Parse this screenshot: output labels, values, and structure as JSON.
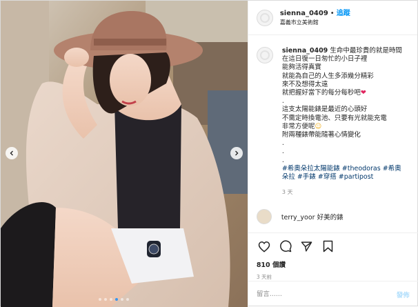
{
  "header": {
    "username": "sienna_0409",
    "separator": "•",
    "follow_label": "追蹤",
    "location": "嘉義市立美術館"
  },
  "caption": {
    "username": "sienna_0409",
    "lines": [
      "生命中最珍貴的就是時間",
      "在這日復一日匆忙的小日子裡",
      "能夠活得真實",
      "就能為自己的人生多添幾分精彩",
      "來不及想得太遠",
      "就把握好當下的每分每秒吧",
      ".",
      "這支太陽能錶是最近的心頭好",
      "不需定時換電池、只要有光就能充電",
      "非常方便呢",
      "附兩種錶帶能隨著心情變化",
      ".",
      ".",
      "."
    ],
    "heart_emoji": "❤",
    "smile_emoji": "☺",
    "hashtags": "#希奧朵拉太陽能錶 #theodoras #希奧朵拉 #手錶 #穿搭 #partipost",
    "time": "3 天"
  },
  "next_comment": {
    "text": "terry_yoor 好美的錶"
  },
  "icons": {
    "like": "heart-icon",
    "comment": "comment-icon",
    "share": "share-icon",
    "save": "bookmark-icon",
    "prev": "chevron-left-icon",
    "next": "chevron-right-icon"
  },
  "engagement": {
    "likes": "810 個讚",
    "date": "3 天前"
  },
  "composer": {
    "placeholder": "留言......",
    "post_label": "發佈"
  },
  "carousel": {
    "count": 6,
    "active_index": 3
  },
  "colors": {
    "accent": "#0095f6",
    "heart": "#e0245e",
    "hashtag": "#00376b",
    "muted": "#8e8e8e"
  }
}
